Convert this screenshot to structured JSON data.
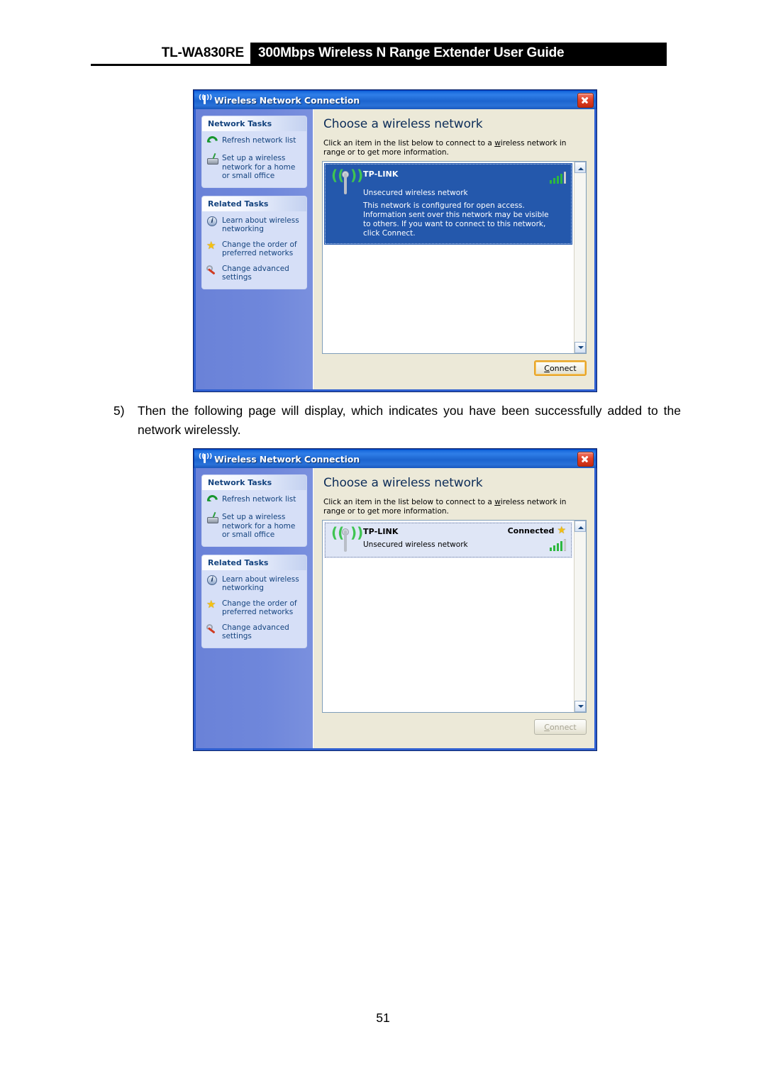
{
  "header": {
    "model": "TL-WA830RE",
    "title": "300Mbps Wireless N Range Extender User Guide"
  },
  "step": {
    "number": "5)",
    "text": "Then the following page will display, which indicates you have been successfully added to the network wirelessly."
  },
  "page_number": "51",
  "dialog_common": {
    "window_title": "Wireless Network Connection",
    "heading": "Choose a wireless network",
    "instruction_pre": "Click an item in the list below to connect to a ",
    "instruction_underlined": "w",
    "instruction_post": "ireless network in range or to get more information.",
    "close_label": "Close",
    "connect_button": "Connect",
    "connect_accel": "C",
    "connect_rest": "onnect",
    "sidebar": {
      "panels": [
        {
          "title": "Network Tasks",
          "items": [
            {
              "label": "Refresh network list",
              "icon": "refresh-icon"
            },
            {
              "label": "Set up a wireless network for a home or small office",
              "icon": "wireless-adapter-icon"
            }
          ]
        },
        {
          "title": "Related Tasks",
          "items": [
            {
              "label": "Learn about wireless networking",
              "icon": "info-icon"
            },
            {
              "label": "Change the order of preferred networks",
              "icon": "star-icon"
            },
            {
              "label": "Change advanced settings",
              "icon": "wrench-icon"
            }
          ]
        }
      ]
    }
  },
  "dialog_1": {
    "network": {
      "ssid": "TP-LINK",
      "security": "Unsecured wireless network",
      "description": "This network is configured for open access. Information sent over this network may be visible to others. If you want to connect to this network, click Connect.",
      "status": "",
      "signal_bars": 4,
      "state": "selected"
    },
    "connect_enabled": true
  },
  "dialog_2": {
    "network": {
      "ssid": "TP-LINK",
      "security": "Unsecured wireless network",
      "description": "",
      "status": "Connected",
      "signal_bars": 4,
      "state": "connected"
    },
    "connect_enabled": false
  },
  "colors": {
    "titlebar_blue": "#2f7ee8",
    "dialog_border": "#2f5fd0",
    "sidebar_blue": "#6f87db",
    "panel_fill": "#d6dff7",
    "panel_text": "#14437e",
    "client_beige": "#ece9d8",
    "selection_blue": "#2458ac",
    "connected_fill": "#dfe6f6",
    "signal_green": "#2db83f",
    "star_yellow": "#f2bf12",
    "close_red": "#e0432a",
    "default_btn_gold": "#e8a427"
  }
}
